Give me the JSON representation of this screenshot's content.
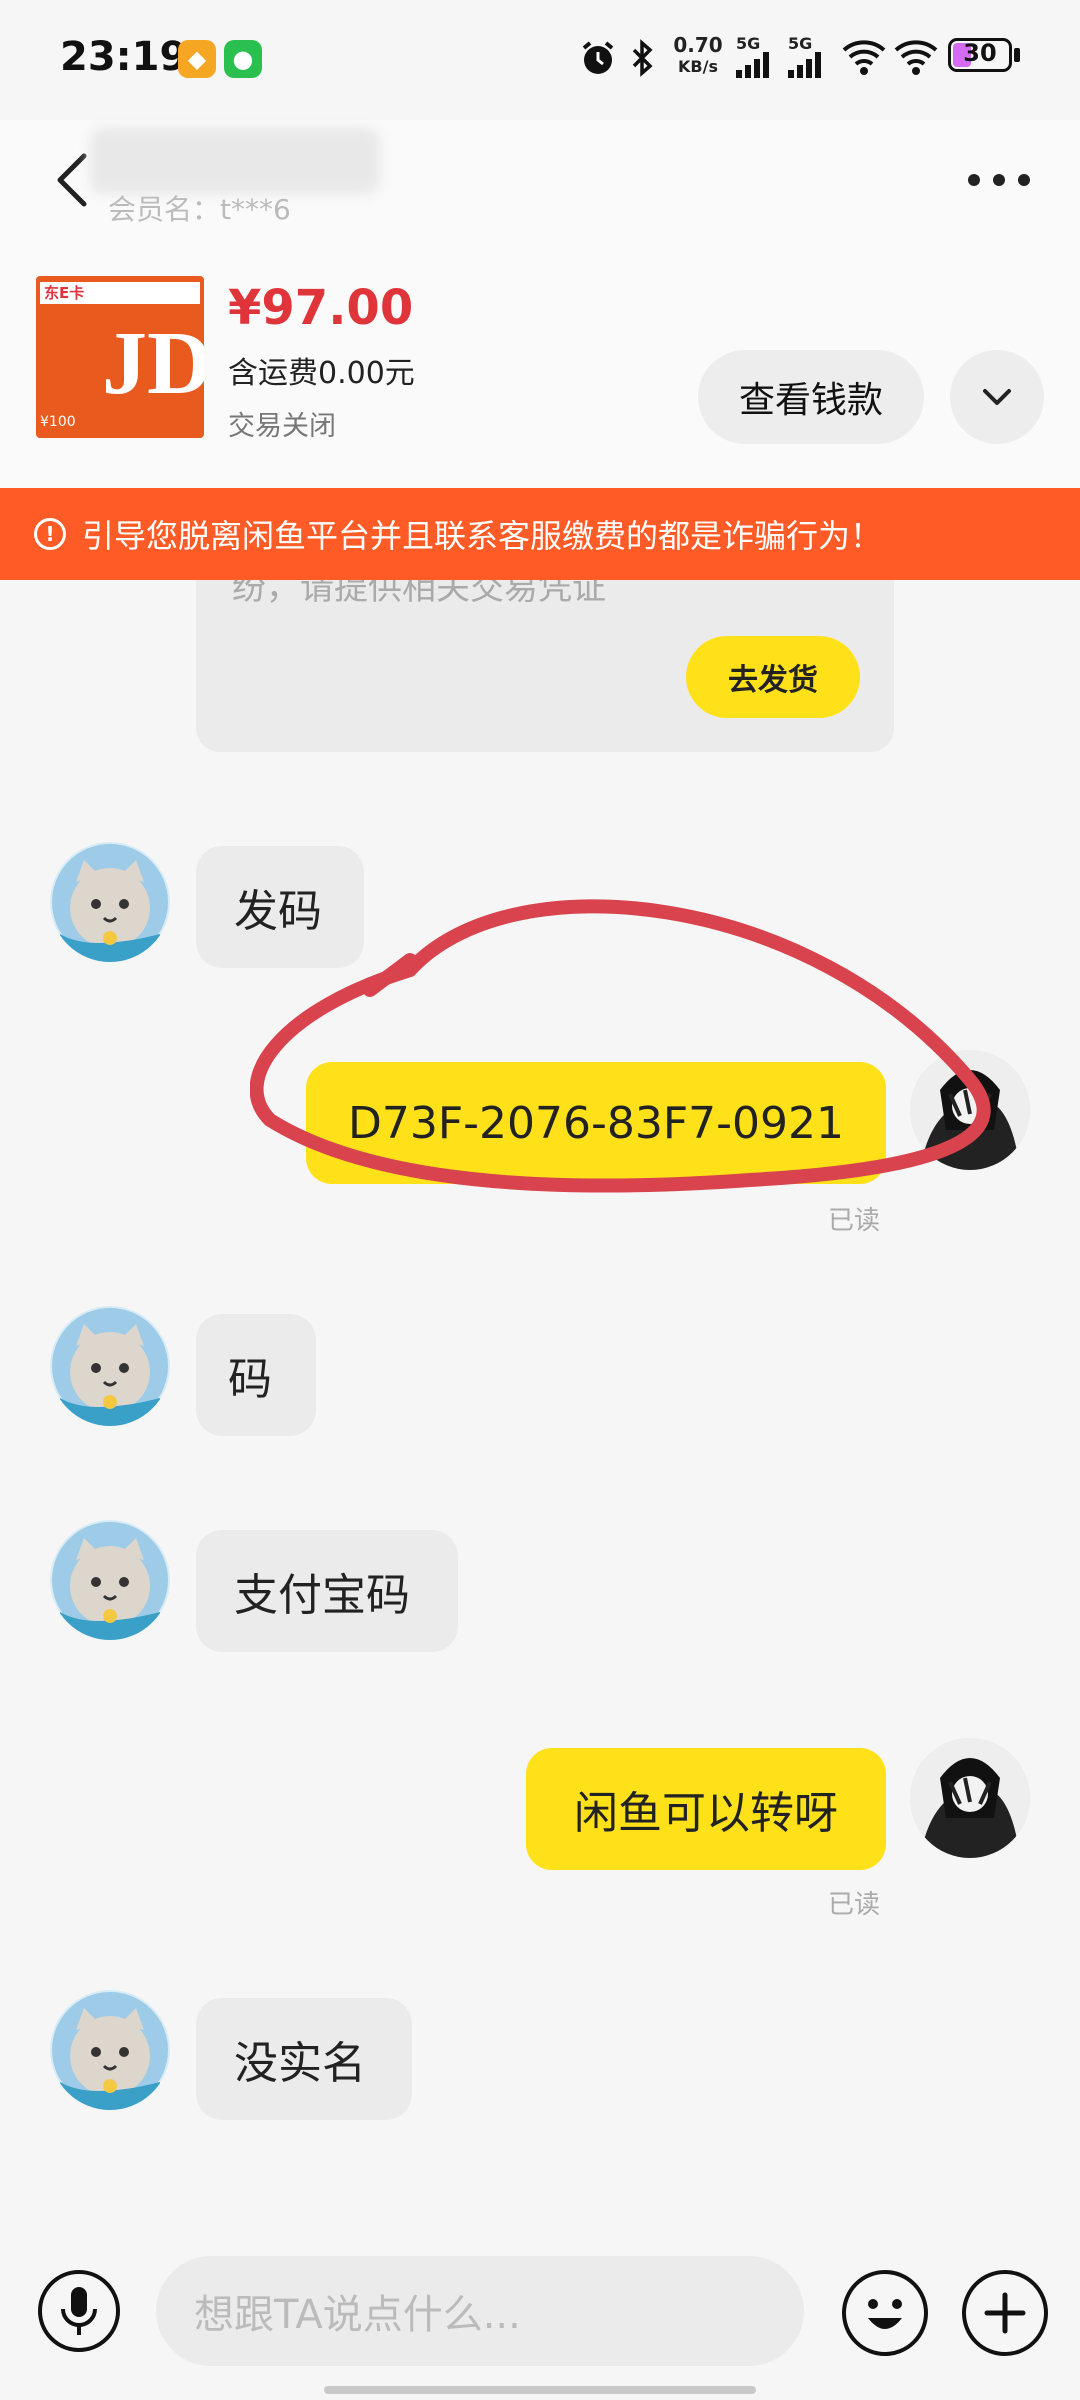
{
  "status_bar": {
    "time": "23:19",
    "net_speed_value": "0.70",
    "net_speed_unit": "KB/s",
    "sim1": "5G",
    "sim2": "5G",
    "battery": "30"
  },
  "header": {
    "seller_sub": "会员名：t***6"
  },
  "product": {
    "card_brand": "东E卡",
    "card_text": "JD",
    "card_value": "¥100",
    "price": "¥97.00",
    "shipping": "含运费0.00元",
    "status": "交易关闭",
    "view_money_label": "查看钱款"
  },
  "warning": {
    "text": "引导您脱离闲鱼平台并且联系客服缴费的都是诈骗行为！"
  },
  "messages": {
    "card_text": "纷，请提供相关交易凭证",
    "ship_button": "去发货",
    "m1": "发码",
    "m2": "D73F-2076-83F7-0921",
    "m3": "码",
    "m4": "支付宝码",
    "m5": "闲鱼可以转呀",
    "m6": "没实名",
    "read_label": "已读"
  },
  "input": {
    "placeholder": "想跟TA说点什么..."
  },
  "colors": {
    "accent_yellow": "#ffe11a",
    "warning_orange": "#ff5b26",
    "price_red": "#e0343b",
    "annotation_red": "#d8434e"
  }
}
